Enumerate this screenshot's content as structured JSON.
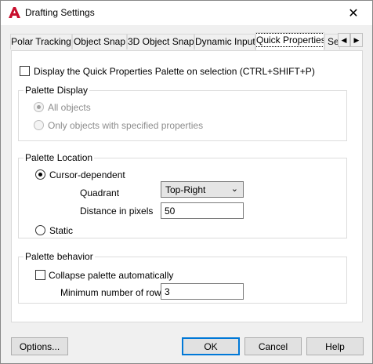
{
  "window": {
    "title": "Drafting Settings",
    "close_glyph": "✕",
    "icon": "autocad-a-icon"
  },
  "tabs": [
    {
      "label": "Polar Tracking"
    },
    {
      "label": "Object Snap"
    },
    {
      "label": "3D Object Snap"
    },
    {
      "label": "Dynamic Input"
    },
    {
      "label": "Quick Properties",
      "active": true
    },
    {
      "label": "Se"
    }
  ],
  "tab_scroll": {
    "left": "◀",
    "right": "▶"
  },
  "display_palette": {
    "label": "Display the Quick Properties Palette on selection (CTRL+SHIFT+P)",
    "checked": false
  },
  "palette_display": {
    "title": "Palette Display",
    "options": [
      {
        "label": "All objects",
        "selected": true,
        "enabled": false
      },
      {
        "label": "Only objects with specified properties",
        "selected": false,
        "enabled": false
      }
    ]
  },
  "palette_location": {
    "title": "Palette Location",
    "cursor_dependent_label": "Cursor-dependent",
    "cursor_dependent_selected": true,
    "quadrant_label": "Quadrant",
    "quadrant_value": "Top-Right",
    "distance_label": "Distance in pixels",
    "distance_value": "50",
    "static_label": "Static",
    "static_selected": false
  },
  "palette_behavior": {
    "title": "Palette behavior",
    "collapse_label": "Collapse palette automatically",
    "collapse_checked": false,
    "min_rows_label": "Minimum number of rows",
    "min_rows_value": "3"
  },
  "buttons": {
    "options": "Options...",
    "ok": "OK",
    "cancel": "Cancel",
    "help": "Help"
  },
  "colors": {
    "accent": "#0078d7",
    "app_icon_red": "#c8102e"
  }
}
